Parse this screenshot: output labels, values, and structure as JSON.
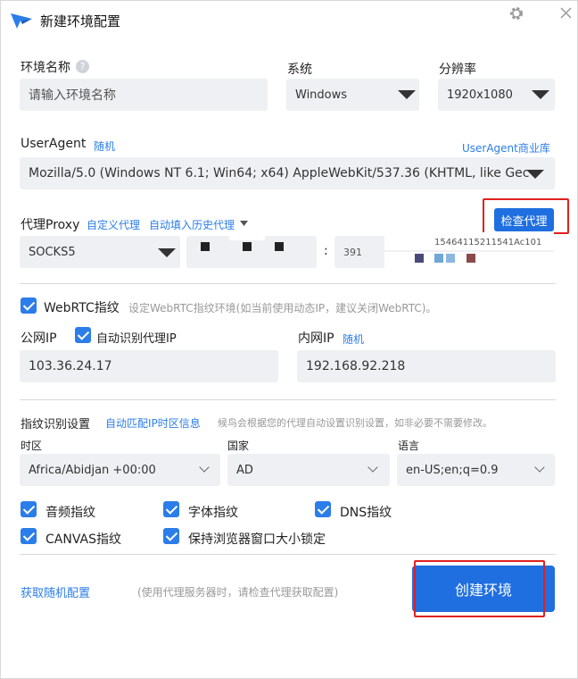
{
  "window": {
    "title": "新建环境配置",
    "accent": "#2b7de9",
    "button_blue": "#1f6fe0"
  },
  "env": {
    "name_label": "环境名称",
    "help_glyph": "?",
    "name_placeholder": "请输入环境名称",
    "system_label": "系统",
    "system_value": "Windows",
    "resolution_label": "分辨率",
    "resolution_value": "1920x1080"
  },
  "ua": {
    "label": "UserAgent",
    "random_link": "随机",
    "library_link": "UserAgent商业库",
    "value": "Mozilla/5.0 (Windows NT 6.1; Win64; x64) AppleWebKit/537.36 (KHTML, like Gec"
  },
  "proxy": {
    "label": "代理Proxy",
    "custom_link": "自定义代理",
    "autofill_link": "自动填入历史代理",
    "check_button": "检查代理",
    "type_value": "SOCKS5",
    "colon": ":",
    "port_partial": "391",
    "user_partial": "15464115211541Ac101"
  },
  "webrtc": {
    "label": "WebRTC指纹",
    "hint": "设定WebRTC指纹环境(如当前使用动态IP，建议关闭WebRTC)。"
  },
  "ip": {
    "public_label": "公网IP",
    "auto_detect_label": "自动识别代理IP",
    "public_value": "103.36.24.17",
    "private_label": "内网IP",
    "private_random_link": "随机",
    "private_value": "192.168.92.218"
  },
  "fingerprint": {
    "label": "指纹识别设置",
    "auto_match_link": "自动匹配IP时区信息",
    "hint": "候鸟会根据您的代理自动设置识别设置，如非必要不需要修改。",
    "timezone_label": "时区",
    "timezone_value": "Africa/Abidjan +00:00",
    "country_label": "国家",
    "country_value": "AD",
    "language_label": "语言",
    "language_value": "en-US;en;q=0.9"
  },
  "options": {
    "audio": "音频指纹",
    "font": "字体指纹",
    "dns": "DNS指纹",
    "canvas": "CANVAS指纹",
    "keep_window": "保持浏览器窗口大小锁定"
  },
  "footer": {
    "random_config_link": "获取随机配置",
    "hint": "(使用代理服务器时，请检查代理获取配置)",
    "create_button": "创建环境"
  }
}
